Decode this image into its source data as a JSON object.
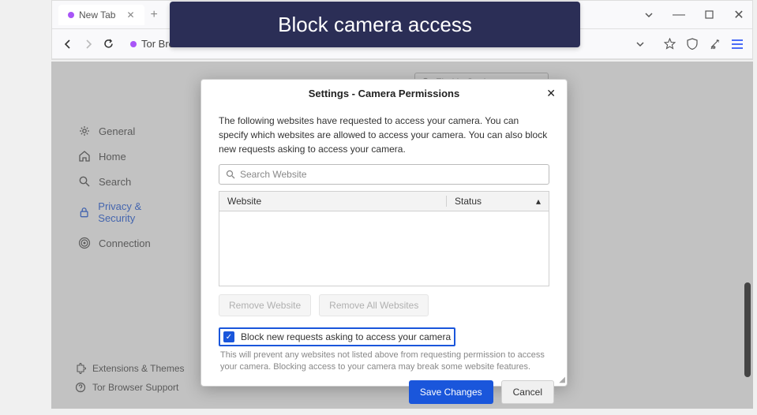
{
  "banner": {
    "text": "Block camera access"
  },
  "tab": {
    "title": "New Tab"
  },
  "url_bar": {
    "text": "Tor Browser"
  },
  "search_settings": {
    "placeholder": "Find in Settings"
  },
  "sidebar": {
    "items": [
      {
        "label": "General"
      },
      {
        "label": "Home"
      },
      {
        "label": "Search"
      },
      {
        "label": "Privacy & Security"
      },
      {
        "label": "Connection"
      }
    ],
    "footer": [
      {
        "label": "Extensions & Themes"
      },
      {
        "label": "Tor Browser Support"
      }
    ]
  },
  "dialog": {
    "title": "Settings - Camera Permissions",
    "description": "The following websites have requested to access your camera. You can specify which websites are allowed to access your camera. You can also block new requests asking to access your camera.",
    "search_placeholder": "Search Website",
    "columns": {
      "website": "Website",
      "status": "Status"
    },
    "buttons": {
      "remove_website": "Remove Website",
      "remove_all": "Remove All Websites",
      "save": "Save Changes",
      "cancel": "Cancel"
    },
    "checkbox_label": "Block new requests asking to access your camera",
    "checkbox_hint": "This will prevent any websites not listed above from requesting permission to access your camera. Blocking access to your camera may break some website features."
  }
}
